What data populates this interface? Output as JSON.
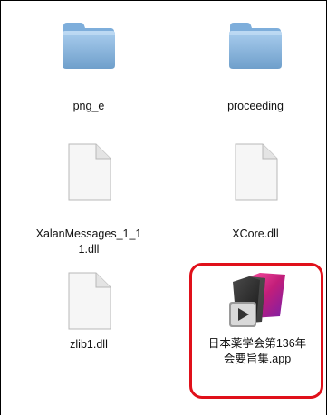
{
  "window": {
    "title": ""
  },
  "files": [
    {
      "name": "png_e",
      "kind": "folder",
      "icon": "folder-icon"
    },
    {
      "name": "proceeding",
      "kind": "folder",
      "icon": "folder-icon"
    },
    {
      "name": "XalanMessages_1_1\n1.dll",
      "kind": "document",
      "icon": "document-icon"
    },
    {
      "name": "XCore.dll",
      "kind": "document",
      "icon": "document-icon"
    },
    {
      "name": "zlib1.dll",
      "kind": "document",
      "icon": "document-icon"
    },
    {
      "name": "日本薬学会第136年\n会要旨集.app",
      "kind": "application",
      "icon": "app-icon",
      "highlighted": true
    }
  ],
  "colors": {
    "highlight": "#e0101a",
    "folder": "#8cb9e0",
    "document": "#f4f4f4"
  }
}
